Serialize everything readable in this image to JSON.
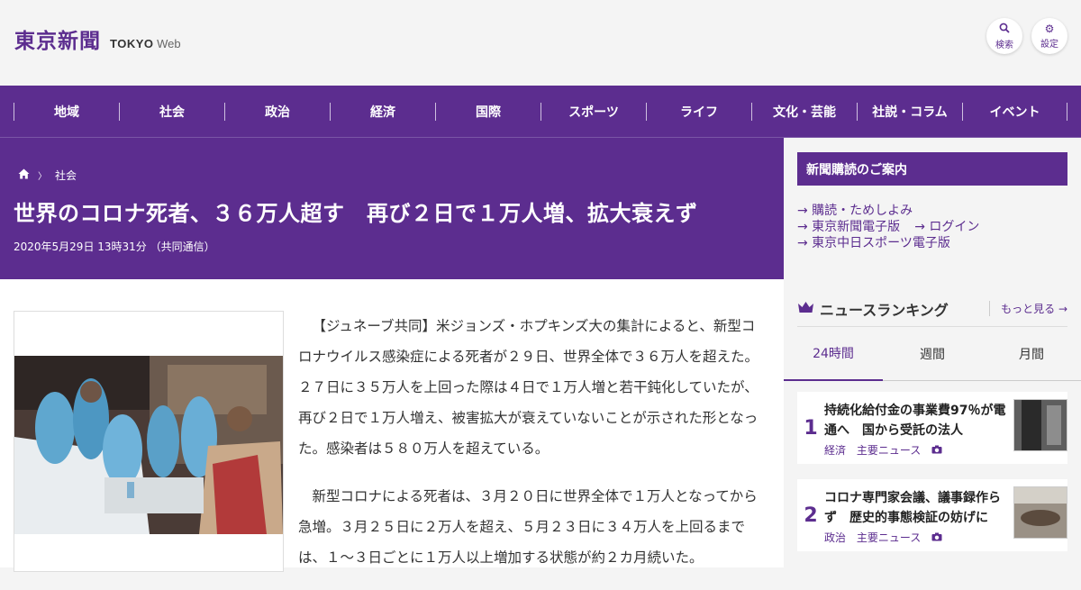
{
  "header": {
    "logo_jp": "東京新聞",
    "logo_en_bold": "TOKYO",
    "logo_en_light": "Web",
    "search_label": "検索",
    "settings_label": "設定"
  },
  "nav": {
    "items": [
      "地域",
      "社会",
      "政治",
      "経済",
      "国際",
      "スポーツ",
      "ライフ",
      "文化・芸能",
      "社説・コラム",
      "イベント"
    ]
  },
  "article": {
    "breadcrumb_category": "社会",
    "title": "世界のコロナ死者、３６万人超す　再び２日で１万人増、拡大衰えず",
    "meta": "2020年5月29日 13時31分 （共同通信）",
    "paragraphs": [
      "【ジュネーブ共同】米ジョンズ・ホプキンズ大の集計によると、新型コロナウイルス感染症による死者が２９日、世界全体で３６万人を超えた。２７日に３５万人を上回った際は４日で１万人増と若干鈍化していたが、再び２日で１万人増え、被害拡大が衰えていないことが示された形となった。感染者は５８０万人を超えている。",
      "新型コロナによる死者は、３月２０日に世界全体で１万人となってから急増。３月２５日に２万人を超え、５月２３日に３４万人を上回るまでは、１～３日ごとに１万人以上増加する状態が約２カ月続いた。"
    ]
  },
  "sidebar": {
    "subscription_title": "新聞購読のご案内",
    "links": {
      "trial": "→ 購読・ためしよみ",
      "digital": "→ 東京新聞電子版",
      "login": "→ ログイン",
      "sports": "→ 東京中日スポーツ電子版"
    },
    "ranking_title": "ニュースランキング",
    "more_label": "もっと見る →",
    "tabs": [
      "24時間",
      "週間",
      "月間"
    ],
    "items": [
      {
        "rank": "1",
        "title": "持続化給付金の事業費97％が電通へ　国から受託の法人",
        "cat": "経済",
        "tag": "主要ニュース"
      },
      {
        "rank": "2",
        "title": "コロナ専門家会議、議事録作らず　歴史的事態検証の妨げに",
        "cat": "政治",
        "tag": "主要ニュース"
      }
    ]
  },
  "colors": {
    "brand": "#5c2d8f",
    "background": "#f4f4f4"
  }
}
